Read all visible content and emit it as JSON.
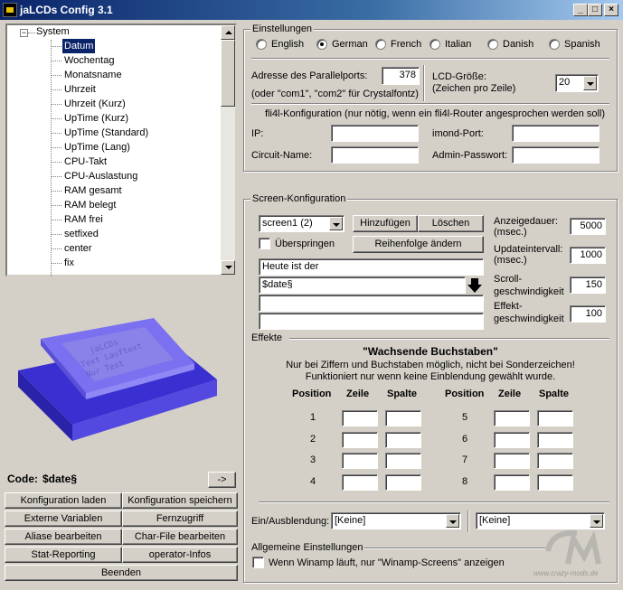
{
  "window": {
    "title": "jaLCDs Config 3.1",
    "minimize": "_",
    "maximize": "□",
    "close": "×"
  },
  "tree": {
    "root": "System",
    "items": [
      "Datum",
      "Wochentag",
      "Monatsname",
      "Uhrzeit",
      "Uhrzeit (Kurz)",
      "UpTime (Kurz)",
      "UpTime (Standard)",
      "UpTime (Lang)",
      "CPU-Takt",
      "CPU-Auslastung",
      "RAM gesamt",
      "RAM belegt",
      "RAM frei",
      "setfixed",
      "center",
      "fix"
    ],
    "selected": "Datum"
  },
  "code": {
    "label": "Code:",
    "value": "$date§",
    "arrow_button": "->"
  },
  "buttons": {
    "load_config": "Konfiguration laden",
    "save_config": "Konfiguration speichern",
    "external_vars": "Externe Variablen",
    "remote_access": "Fernzugriff",
    "edit_aliases": "Aliase bearbeiten",
    "edit_charfile": "Char-File bearbeiten",
    "stat_reporting": "Stat-Reporting",
    "operator_infos": "operator-Infos",
    "quit": "Beenden"
  },
  "settings": {
    "title": "Einstellungen",
    "languages": [
      "English",
      "German",
      "French",
      "Italian",
      "Danish",
      "Spanish"
    ],
    "selected_language": "German",
    "parallel_port_label": "Adresse des Parallelports:",
    "parallel_port_value": "378",
    "parallel_port_hint": "(oder \"com1\", \"com2\" für Crystalfontz)",
    "lcd_size_label": "LCD-Größe:",
    "lcd_size_hint": "(Zeichen pro Zeile)",
    "lcd_size_value": "20",
    "fli4l_note": "fli4l-Konfiguration (nur nötig, wenn ein fli4l-Router angesprochen werden soll)",
    "ip_label": "IP:",
    "ip_value": "",
    "imond_port_label": "imond-Port:",
    "imond_port_value": "",
    "circuit_name_label": "Circuit-Name:",
    "circuit_name_value": "",
    "admin_password_label": "Admin-Passwort:",
    "admin_password_value": ""
  },
  "screen": {
    "title": "Screen-Konfiguration",
    "selected_screen": "screen1 (2)",
    "add_button": "Hinzufügen",
    "delete_button": "Löschen",
    "skip_label": "Überspringen",
    "reorder_button": "Reihenfolge ändern",
    "lines": [
      "Heute ist der",
      "$date§",
      "",
      ""
    ],
    "display_duration_label": "Anzeigedauer:",
    "display_duration_unit": "(msec.)",
    "display_duration_value": "5000",
    "update_interval_label": "Updateintervall:",
    "update_interval_unit": "(msec.)",
    "update_interval_value": "1000",
    "scroll_speed_label1": "Scroll-",
    "scroll_speed_label2": "geschwindigkeit",
    "scroll_speed_value": "150",
    "effect_speed_label1": "Effekt-",
    "effect_speed_label2": "geschwindigkeit",
    "effect_speed_value": "100"
  },
  "effects": {
    "title": "Effekte",
    "heading": "\"Wachsende Buchstaben\"",
    "desc1": "Nur bei Ziffern und Buchstaben möglich, nicht bei Sonderzeichen!",
    "desc2": "Funktioniert nur wenn keine Einblendung gewählt wurde.",
    "col_position": "Position",
    "col_zeile": "Zeile",
    "col_spalte": "Spalte",
    "positions_left": [
      "1",
      "2",
      "3",
      "4"
    ],
    "positions_right": [
      "5",
      "6",
      "7",
      "8"
    ]
  },
  "fade": {
    "label": "Ein/Ausblendung:",
    "value1": "[Keine]",
    "value2": "[Keine]"
  },
  "general": {
    "title": "Allgemeine Einstellungen",
    "winamp_label": "Wenn Winamp läuft, nur \"Winamp-Screens\" anzeigen"
  },
  "watermark": "www.crazy-mods.de",
  "colors": {
    "titlebar": "#0a246a",
    "selection": "#0a246a",
    "lcd_body": "#6b5fe8"
  }
}
